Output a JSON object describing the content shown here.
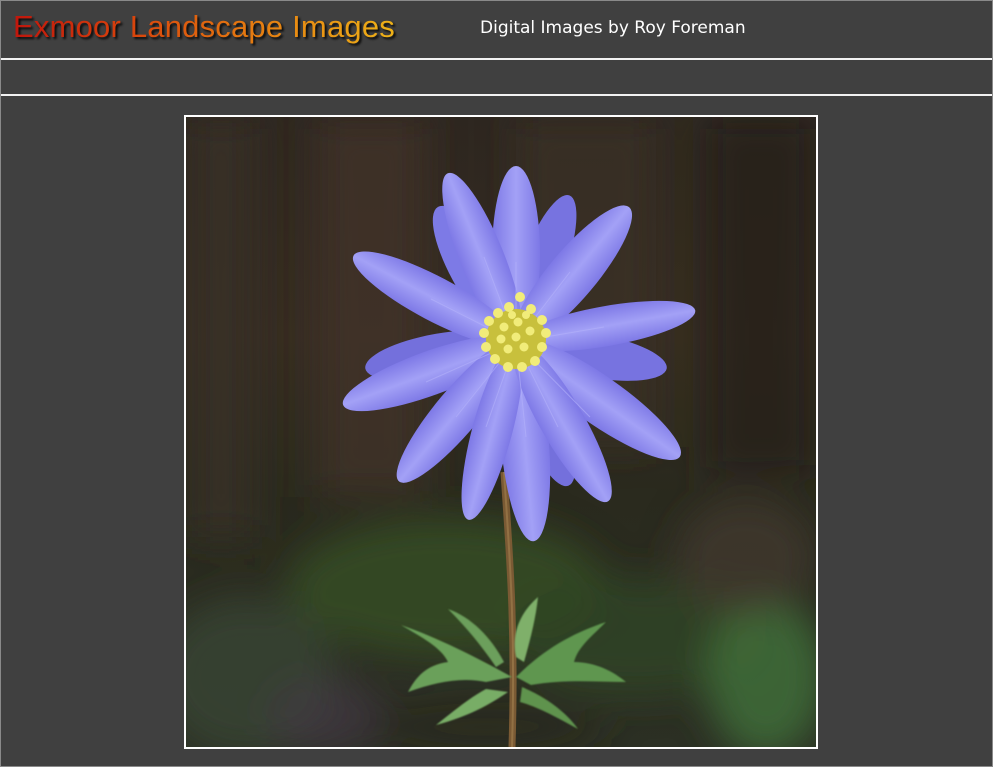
{
  "header": {
    "site_title": "Exmoor Landscape Images",
    "subtitle": "Digital Images by Roy Foreman"
  },
  "photo": {
    "subject": "blue anemone flower",
    "colors": {
      "background": "#404040",
      "petal": "#8f8cf0",
      "stamen": "#e8e06a",
      "leaf": "#6aa05a"
    }
  }
}
